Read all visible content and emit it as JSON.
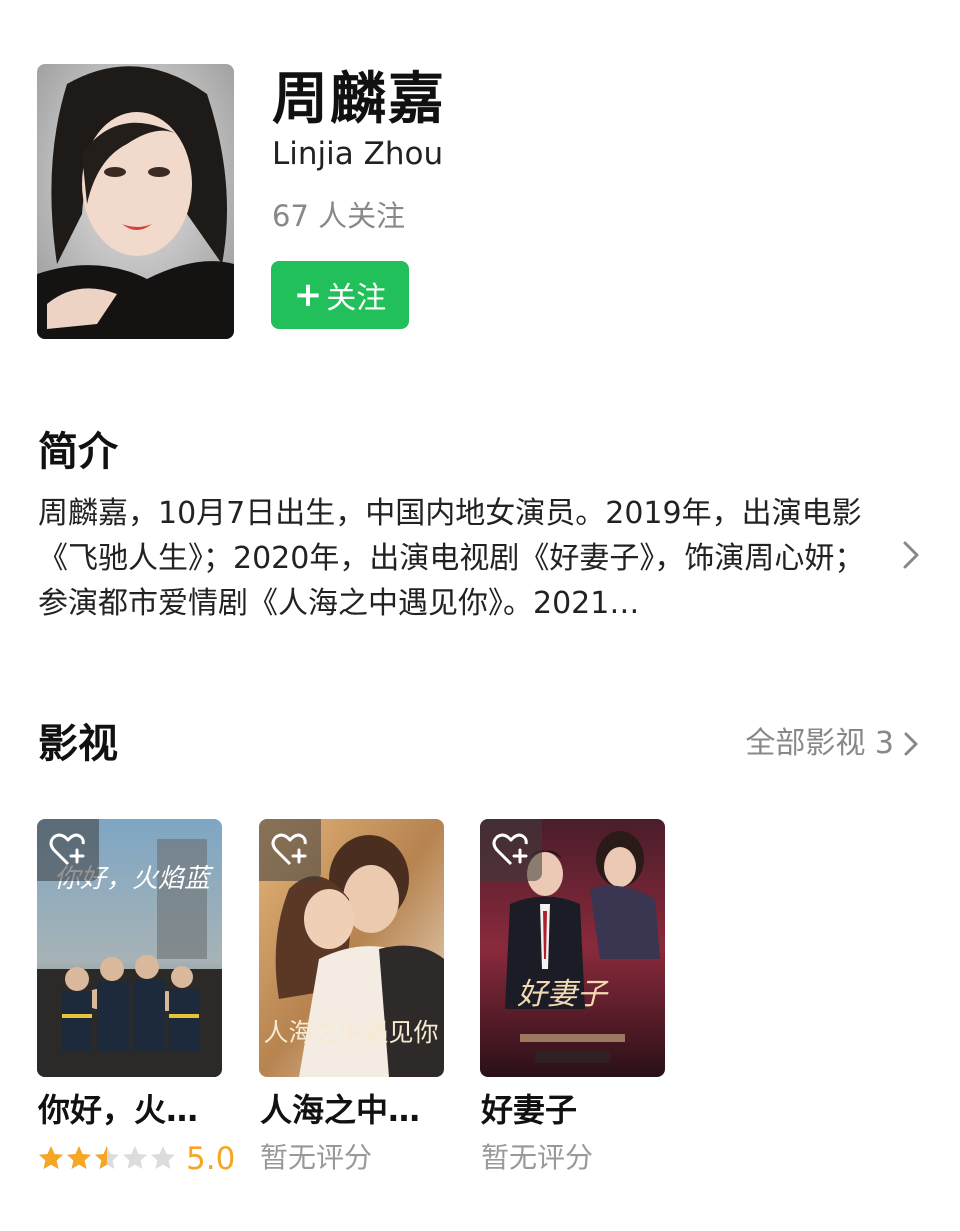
{
  "profile": {
    "name_cn": "周麟嘉",
    "name_en": "Linjia Zhou",
    "followers": "67 人关注",
    "follow_button": "关注"
  },
  "bio": {
    "title": "简介",
    "text": "周麟嘉，10月7日出生，中国内地女演员。2019年，出演电影《飞驰人生》；2020年，出演电视剧《好妻子》，饰演周心妍；参演都市爱情剧《人海之中遇见你》。2021…"
  },
  "films": {
    "title": "影视",
    "all_link": "全部影视 3",
    "items": [
      {
        "title": "你好，火…",
        "rating_text": "",
        "score": "5.0",
        "stars": 2.5,
        "poster_text": "你好，火焰蓝"
      },
      {
        "title": "人海之中…",
        "rating_text": "暂无评分",
        "poster_text": "人海之中遇见你"
      },
      {
        "title": "好妻子",
        "rating_text": "暂无评分",
        "poster_text": "好妻子"
      }
    ]
  },
  "colors": {
    "follow_green": "#22c05a",
    "star_gold": "#f5a623",
    "muted_gray": "#888888"
  },
  "icons": {
    "follow_plus": "plus-icon",
    "bio_more": "chevron-right-icon",
    "favorite": "heart-plus-icon"
  }
}
